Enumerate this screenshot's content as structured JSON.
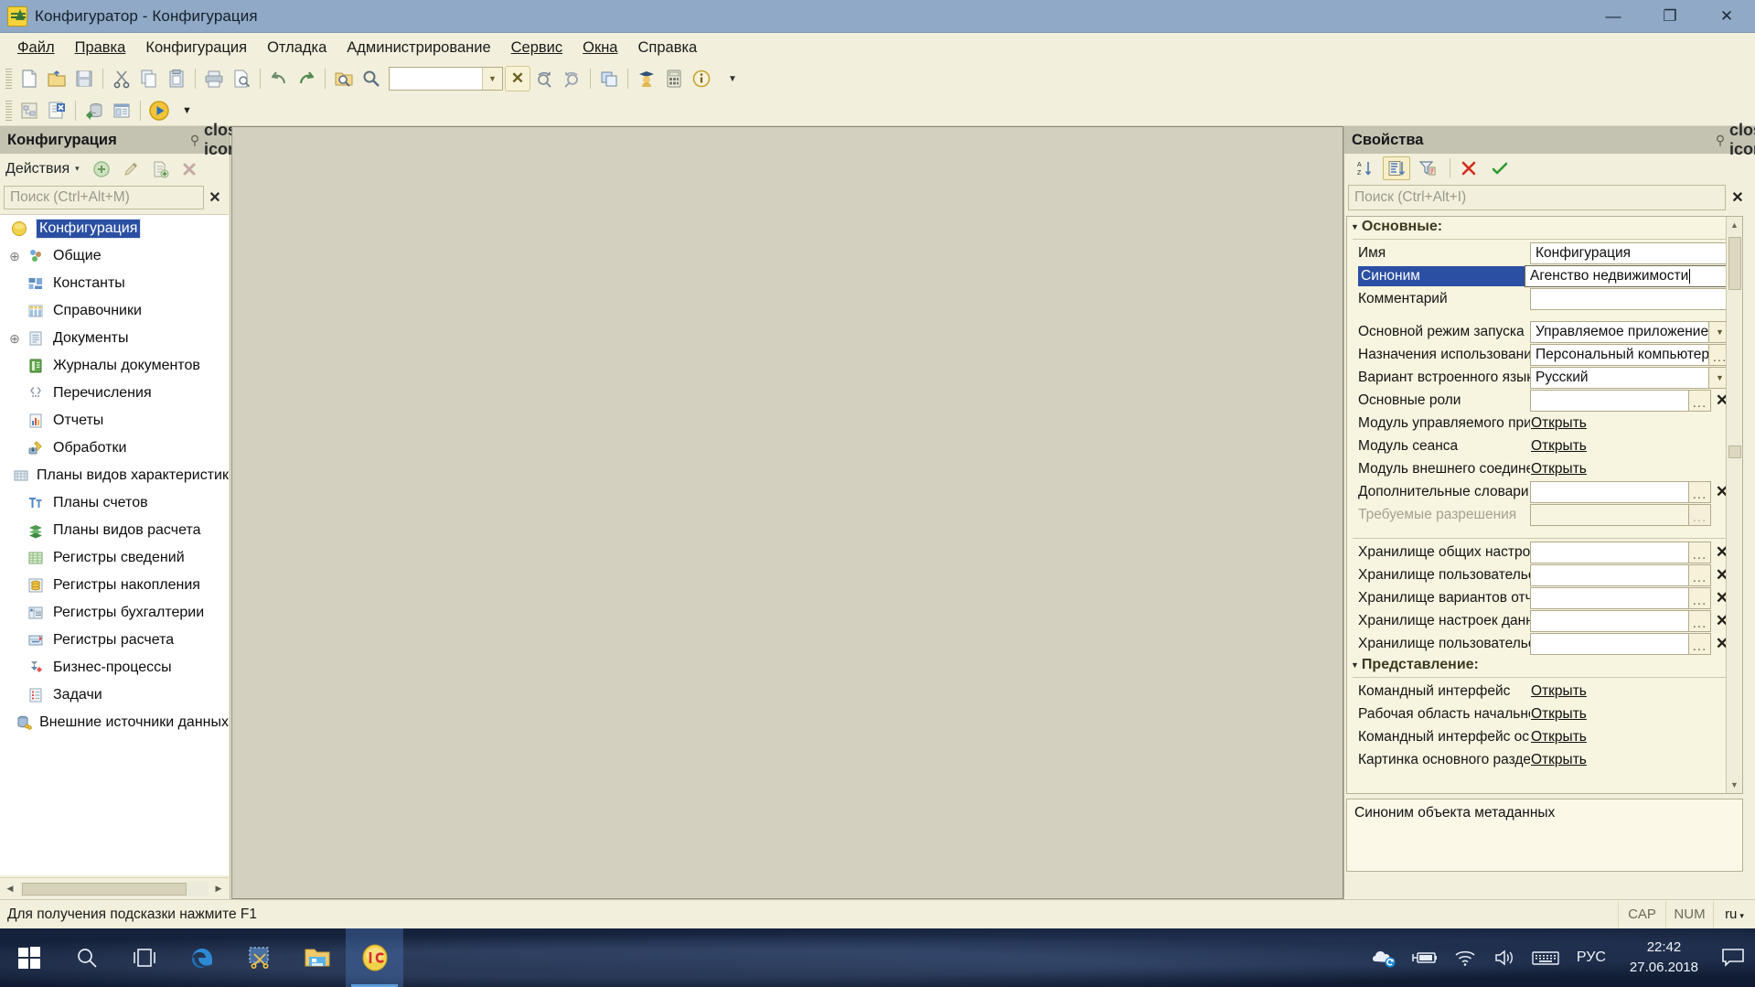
{
  "window": {
    "title": "Конфигуратор - Конфигурация",
    "app_icon": "1c-configurator-icon",
    "minimize": "—",
    "maximize": "❐",
    "close": "✕"
  },
  "menubar": {
    "items": [
      {
        "label": "Файл",
        "accel": "Ф"
      },
      {
        "label": "Правка",
        "accel": "П"
      },
      {
        "label": "Конфигурация",
        "accel": ""
      },
      {
        "label": "Отладка",
        "accel": ""
      },
      {
        "label": "Администрирование",
        "accel": ""
      },
      {
        "label": "Сервис",
        "accel": "С"
      },
      {
        "label": "Окна",
        "accel": "О"
      },
      {
        "label": "Справка",
        "accel": ""
      }
    ]
  },
  "toolbar_row1": {
    "buttons": [
      "new-document-icon",
      "open-folder-icon",
      "save-icon",
      "cut-scissors-icon",
      "copy-icon",
      "paste-icon",
      "print-icon",
      "print-preview-icon",
      "undo-arrow-icon",
      "redo-arrow-icon",
      "find-in-folder-icon",
      "search-magnifier-icon"
    ],
    "combo_value": "",
    "clear_button_label": "✕",
    "buttons_after": [
      "find-next-icon",
      "find-previous-icon",
      "windows-cascade-icon",
      "syntax-assistant-icon",
      "calculator-icon",
      "about-icon"
    ]
  },
  "toolbar_row2": {
    "buttons": [
      "configuration-tree-icon",
      "compare-configuration-icon",
      "database-update-icon",
      "config-properties-icon",
      "start-debug-icon"
    ],
    "dropdown_caret": "▼"
  },
  "left_panel": {
    "title": "Конфигурация",
    "pin_icon": "pin-icon",
    "close_icon": "close-icon",
    "actions_label": "Действия",
    "actions_caret": "▾",
    "action_buttons": [
      "add-icon",
      "edit-icon",
      "copy-item-icon",
      "delete-icon"
    ],
    "search_placeholder": "Поиск (Ctrl+Alt+M)",
    "search_value": "",
    "search_clear": "✕",
    "tree": [
      {
        "label": "Конфигурация",
        "icon": "configuration-root-icon",
        "expandable": false,
        "selected": true,
        "indent": 0
      },
      {
        "label": "Общие",
        "icon": "common-icon",
        "expandable": true,
        "selected": false,
        "indent": 1
      },
      {
        "label": "Константы",
        "icon": "constants-icon",
        "expandable": false,
        "selected": false,
        "indent": 1
      },
      {
        "label": "Справочники",
        "icon": "catalogs-icon",
        "expandable": false,
        "selected": false,
        "indent": 1
      },
      {
        "label": "Документы",
        "icon": "documents-icon",
        "expandable": true,
        "selected": false,
        "indent": 1
      },
      {
        "label": "Журналы документов",
        "icon": "document-journals-icon",
        "expandable": false,
        "selected": false,
        "indent": 1
      },
      {
        "label": "Перечисления",
        "icon": "enums-icon",
        "expandable": false,
        "selected": false,
        "indent": 1
      },
      {
        "label": "Отчеты",
        "icon": "reports-icon",
        "expandable": false,
        "selected": false,
        "indent": 1
      },
      {
        "label": "Обработки",
        "icon": "data-processors-icon",
        "expandable": false,
        "selected": false,
        "indent": 1
      },
      {
        "label": "Планы видов характеристик",
        "icon": "chart-of-characteristic-types-icon",
        "expandable": false,
        "selected": false,
        "indent": 1
      },
      {
        "label": "Планы счетов",
        "icon": "chart-of-accounts-icon",
        "expandable": false,
        "selected": false,
        "indent": 1
      },
      {
        "label": "Планы видов расчета",
        "icon": "chart-of-calculation-types-icon",
        "expandable": false,
        "selected": false,
        "indent": 1
      },
      {
        "label": "Регистры сведений",
        "icon": "information-registers-icon",
        "expandable": false,
        "selected": false,
        "indent": 1
      },
      {
        "label": "Регистры накопления",
        "icon": "accumulation-registers-icon",
        "expandable": false,
        "selected": false,
        "indent": 1
      },
      {
        "label": "Регистры бухгалтерии",
        "icon": "accounting-registers-icon",
        "expandable": false,
        "selected": false,
        "indent": 1
      },
      {
        "label": "Регистры расчета",
        "icon": "calculation-registers-icon",
        "expandable": false,
        "selected": false,
        "indent": 1
      },
      {
        "label": "Бизнес-процессы",
        "icon": "business-processes-icon",
        "expandable": false,
        "selected": false,
        "indent": 1
      },
      {
        "label": "Задачи",
        "icon": "tasks-icon",
        "expandable": false,
        "selected": false,
        "indent": 1
      },
      {
        "label": "Внешние источники данных",
        "icon": "external-data-sources-icon",
        "expandable": false,
        "selected": false,
        "indent": 1
      }
    ],
    "hscroll": {
      "left_arrow": "◀",
      "right_arrow": "▶"
    }
  },
  "right_panel": {
    "title": "Свойства",
    "pin_icon": "pin-icon",
    "close_icon": "close-icon",
    "toolbar": [
      {
        "name": "sort-alphabetical-icon",
        "active": false
      },
      {
        "name": "sort-by-category-icon",
        "active": true
      },
      {
        "name": "filter-icon",
        "active": false
      },
      {
        "name": "cancel-red-x-icon",
        "active": false
      },
      {
        "name": "apply-green-check-icon",
        "active": false
      }
    ],
    "search_placeholder": "Поиск (Ctrl+Alt+I)",
    "search_value": "",
    "search_clear": "✕",
    "groups": [
      {
        "title": "Основные",
        "rows": [
          {
            "name": "Имя",
            "type": "text",
            "value": "Конфигурация",
            "selected": false,
            "dim": false
          },
          {
            "name": "Синоним",
            "type": "text",
            "value": "Агенство недвижимости",
            "selected": true,
            "focused": true,
            "dim": false
          },
          {
            "name": "Комментарий",
            "type": "text",
            "value": "",
            "selected": false,
            "dim": false
          },
          {
            "name": "__spacer__",
            "type": "spacer"
          },
          {
            "name": "Основной режим запуска",
            "type": "dropdown",
            "value": "Управляемое приложение",
            "selected": false,
            "dim": false
          },
          {
            "name": "Назначения использования",
            "type": "ellipsis",
            "value": "Персональный компьютер",
            "selected": false,
            "dim": false
          },
          {
            "name": "Вариант встроенного языка",
            "type": "dropdown",
            "value": "Русский",
            "selected": false,
            "dim": false
          },
          {
            "name": "Основные роли",
            "type": "ellipsis-clear",
            "value": "",
            "selected": false,
            "dim": false
          },
          {
            "name": "Модуль управляемого приложения",
            "type": "link",
            "value": "Открыть",
            "selected": false,
            "dim": false
          },
          {
            "name": "Модуль сеанса",
            "type": "link",
            "value": "Открыть",
            "selected": false,
            "dim": false
          },
          {
            "name": "Модуль внешнего соединения",
            "type": "link",
            "value": "Открыть",
            "selected": false,
            "dim": false
          },
          {
            "name": "Дополнительные словари",
            "type": "ellipsis-clear",
            "value": "",
            "selected": false,
            "dim": false
          },
          {
            "name": "Требуемые разрешения",
            "type": "ellipsis",
            "value": "",
            "selected": false,
            "dim": true
          },
          {
            "name": "__spacer__",
            "type": "spacer"
          },
          {
            "name": "Хранилище общих настроек",
            "type": "ellipsis-clear",
            "value": "",
            "selected": false,
            "dim": false
          },
          {
            "name": "Хранилище пользовательских",
            "type": "ellipsis-clear",
            "value": "",
            "selected": false,
            "dim": false
          },
          {
            "name": "Хранилище вариантов отчетов",
            "type": "ellipsis-clear",
            "value": "",
            "selected": false,
            "dim": false
          },
          {
            "name": "Хранилище настроек данных",
            "type": "ellipsis-clear",
            "value": "",
            "selected": false,
            "dim": false
          },
          {
            "name": "Хранилище пользовательских",
            "type": "ellipsis-clear",
            "value": "",
            "selected": false,
            "dim": false
          }
        ]
      },
      {
        "title": "Представление",
        "rows": [
          {
            "name": "Командный интерфейс",
            "type": "link",
            "value": "Открыть",
            "selected": false,
            "dim": false
          },
          {
            "name": "Рабочая область начальной",
            "type": "link",
            "value": "Открыть",
            "selected": false,
            "dim": false
          },
          {
            "name": "Командный интерфейс основного",
            "type": "link",
            "value": "Открыть",
            "selected": false,
            "dim": false
          },
          {
            "name": "Картинка основного раздела",
            "type": "link",
            "value": "Открыть",
            "selected": false,
            "dim": false
          }
        ]
      }
    ],
    "description": "Синоним объекта метаданных",
    "scroll_up": "▲",
    "scroll_down": "▼"
  },
  "statusbar": {
    "hint": "Для получения подсказки нажмите F1",
    "cap": "CAP",
    "num": "NUM",
    "lang": "ru",
    "lang_caret": "▾"
  },
  "taskbar": {
    "items": [
      {
        "name": "start-windows-icon",
        "active": false
      },
      {
        "name": "search-icon",
        "active": false
      },
      {
        "name": "task-view-icon",
        "active": false
      },
      {
        "name": "edge-browser-icon",
        "active": false
      },
      {
        "name": "snipping-tool-icon",
        "active": false
      },
      {
        "name": "file-explorer-icon",
        "active": false
      },
      {
        "name": "1c-enterprise-icon",
        "active": true
      }
    ],
    "tray": [
      {
        "name": "onedrive-sync-icon"
      },
      {
        "name": "battery-charging-icon"
      },
      {
        "name": "wifi-icon"
      },
      {
        "name": "volume-icon"
      },
      {
        "name": "touch-keyboard-icon"
      }
    ],
    "lang": "РУС",
    "time": "22:42",
    "date": "27.06.2018",
    "notification_icon": "action-center-icon"
  }
}
